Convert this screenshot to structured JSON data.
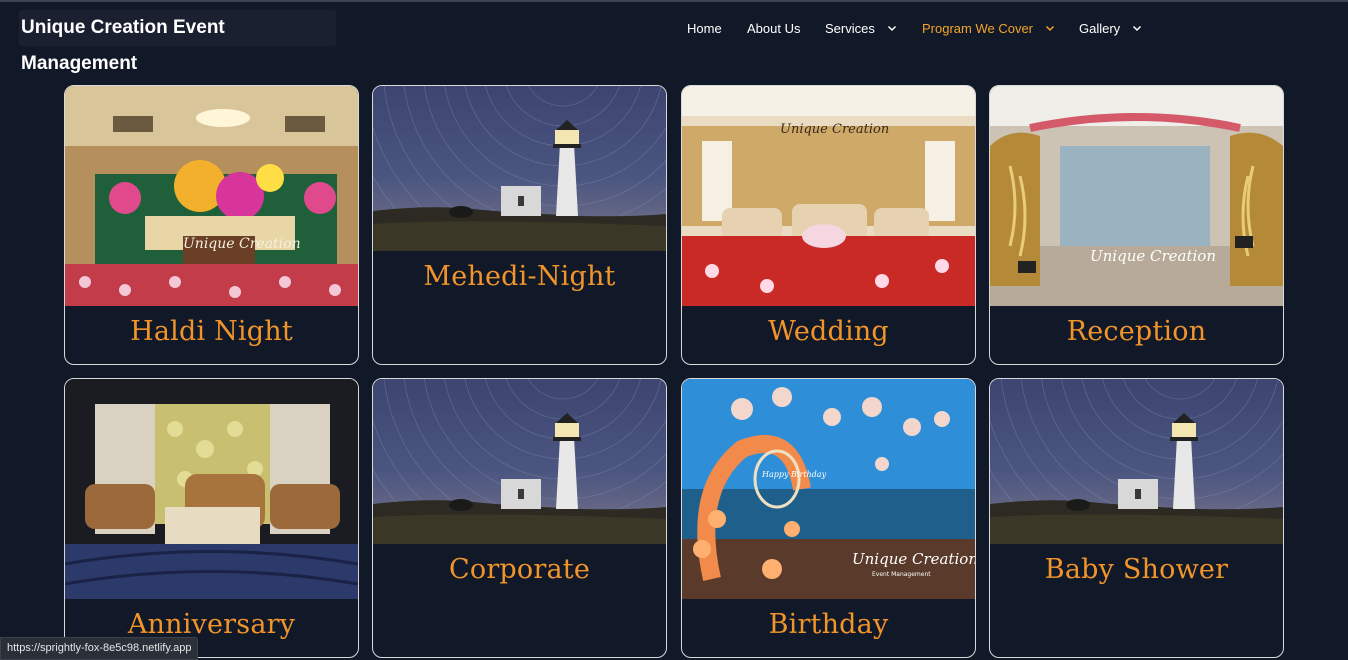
{
  "brand": {
    "title": "Unique Creation Event Management"
  },
  "nav": {
    "home": "Home",
    "about": "About Us",
    "services": "Services",
    "programs": "Program We Cover",
    "gallery": "Gallery"
  },
  "cards": [
    {
      "title": "Haldi Night",
      "watermark": "Unique Creation",
      "photo": "haldi-stage"
    },
    {
      "title": "Mehedi-Night",
      "photo": "lighthouse-placeholder"
    },
    {
      "title": "Wedding",
      "watermark": "Unique Creation",
      "photo": "wedding-stage"
    },
    {
      "title": "Reception",
      "watermark": "Unique Creation",
      "photo": "reception-gate"
    },
    {
      "title": "Anniversary",
      "photo": "anniversary-stage"
    },
    {
      "title": "Corporate",
      "photo": "lighthouse-placeholder"
    },
    {
      "title": "Birthday",
      "watermark": "Unique Creation",
      "watermark_sub": "Event Management",
      "balloon_text": "Happy Birthday",
      "photo": "birthday-balloons"
    },
    {
      "title": "Baby Shower",
      "photo": "lighthouse-placeholder"
    }
  ],
  "status_bar": {
    "url": "https://sprightly-fox-8e5c98.netlify.app"
  },
  "colors": {
    "accent": "#f1952b",
    "nav_active": "#f3a52a",
    "background": "#111827"
  }
}
